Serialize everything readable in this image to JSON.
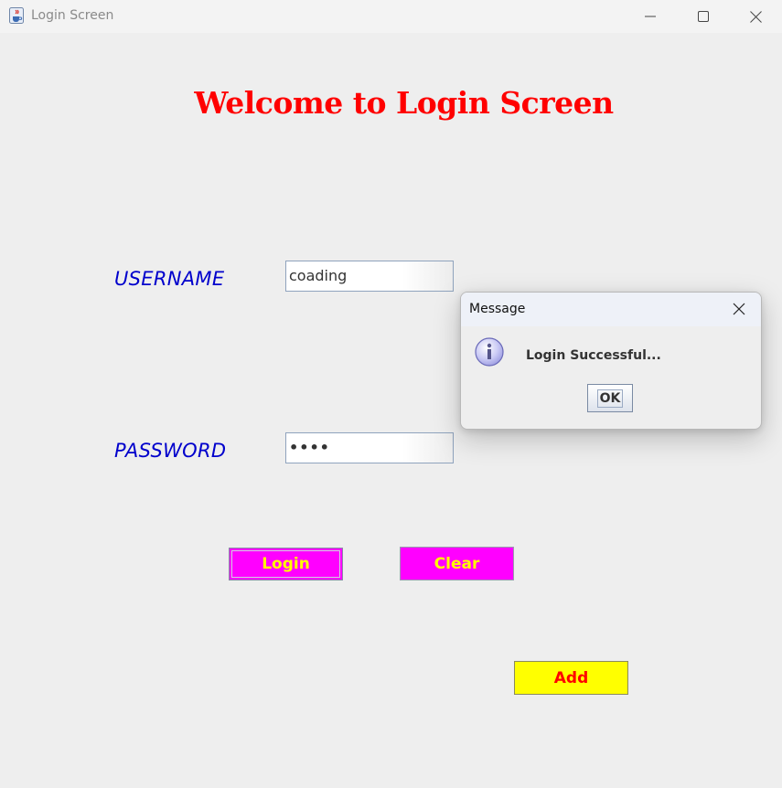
{
  "window": {
    "title": "Login Screen"
  },
  "main": {
    "heading": "Welcome to Login Screen",
    "username_label": "USERNAME",
    "username_value": "coading",
    "password_label": "PASSWORD",
    "password_value": "••••",
    "login_label": "Login",
    "clear_label": "Clear",
    "add_label": "Add"
  },
  "dialog": {
    "title": "Message",
    "message": "Login Successful...",
    "ok_label": "OK"
  },
  "colors": {
    "heading": "#ff0000",
    "label": "#0000cc",
    "login_clear_bg": "#ff00ff",
    "login_clear_text": "#ffff00",
    "add_bg": "#ffff00",
    "add_text": "#ff0000"
  },
  "icons": {
    "app": "java-cup-icon",
    "minimize": "minimize-icon",
    "maximize": "maximize-icon",
    "close": "close-icon",
    "dialog_close": "close-icon",
    "dialog_info": "info-icon"
  }
}
